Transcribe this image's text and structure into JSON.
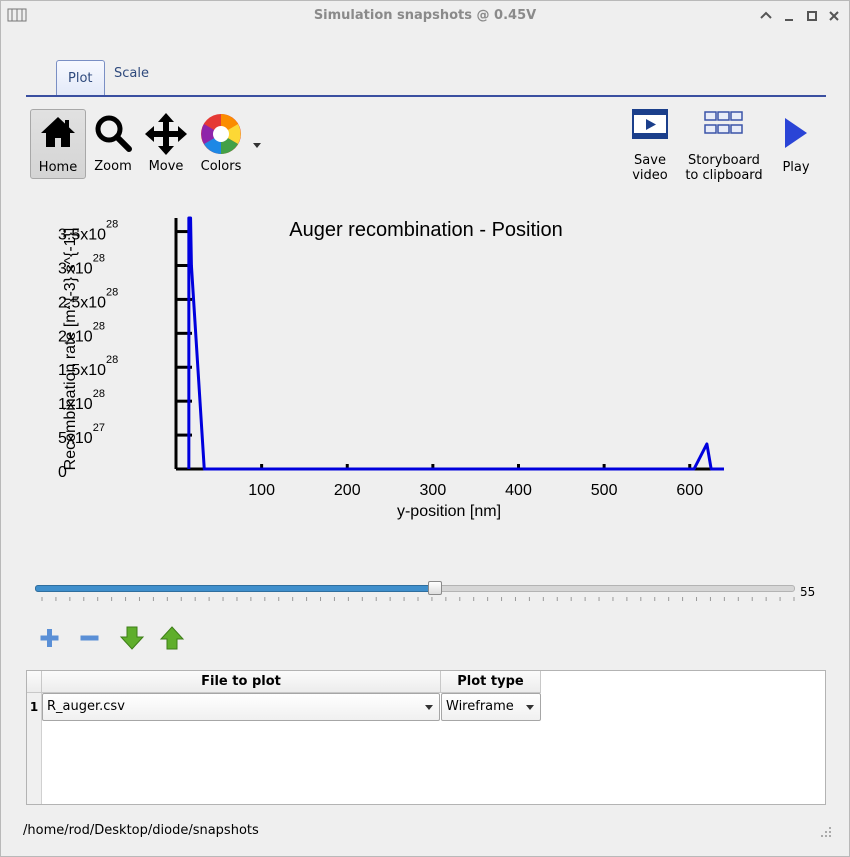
{
  "window": {
    "title": "Simulation snapshots @ 0.45V",
    "controls": [
      "chevron-up-icon",
      "minimize-icon",
      "maximize-icon",
      "close-icon"
    ]
  },
  "tabs": [
    {
      "label": "Plot",
      "active": true
    },
    {
      "label": "Scale",
      "active": false
    }
  ],
  "toolbar": {
    "home_label": "Home",
    "zoom_label": "Zoom",
    "move_label": "Move",
    "colors_label": "Colors",
    "save_video_label_1": "Save",
    "save_video_label_2": "video",
    "storyboard_label_1": "Storyboard",
    "storyboard_label_2": "to clipboard",
    "play_label": "Play"
  },
  "chart_data": {
    "type": "line",
    "title": "Auger recombination - Position",
    "xlabel": "y-position [nm]",
    "ylabel": "Recombination rate [m^{-3} s^{-1}]",
    "xlim": [
      0,
      640
    ],
    "ylim": [
      0,
      3.7e+28
    ],
    "x_ticks": [
      100,
      200,
      300,
      400,
      500,
      600
    ],
    "y_ticks": [
      {
        "value": 0,
        "mantissa": "0",
        "exp": ""
      },
      {
        "value": 5e+27,
        "mantissa": "5x10",
        "exp": "27"
      },
      {
        "value": 1e+28,
        "mantissa": "1x10",
        "exp": "28"
      },
      {
        "value": 1.5e+28,
        "mantissa": "1.5x10",
        "exp": "28"
      },
      {
        "value": 2e+28,
        "mantissa": "2x10",
        "exp": "28"
      },
      {
        "value": 2.5e+28,
        "mantissa": "2.5x10",
        "exp": "28"
      },
      {
        "value": 3e+28,
        "mantissa": "3x10",
        "exp": "28"
      },
      {
        "value": 3.5e+28,
        "mantissa": "3.5x10",
        "exp": "28"
      }
    ],
    "grid": false,
    "series": [
      {
        "color": "#0000dd",
        "x": [
          15,
          15,
          17,
          18,
          33,
          35,
          600,
          605,
          620,
          625,
          640
        ],
        "y": [
          0,
          3.7e+28,
          3.7e+28,
          3e+28,
          0,
          0,
          0,
          0,
          3.7e+27,
          0,
          0
        ]
      }
    ]
  },
  "slider": {
    "value": "55",
    "fraction": 0.527
  },
  "iconbar": [
    "add-icon",
    "remove-icon",
    "move-down-icon",
    "move-up-icon"
  ],
  "table": {
    "headers": {
      "file": "File to plot",
      "type": "Plot type"
    },
    "rows": [
      {
        "num": "1",
        "file": "R_auger.csv",
        "type": "Wireframe"
      }
    ]
  },
  "status": {
    "path": "/home/rod/Desktop/diode/snapshots"
  }
}
